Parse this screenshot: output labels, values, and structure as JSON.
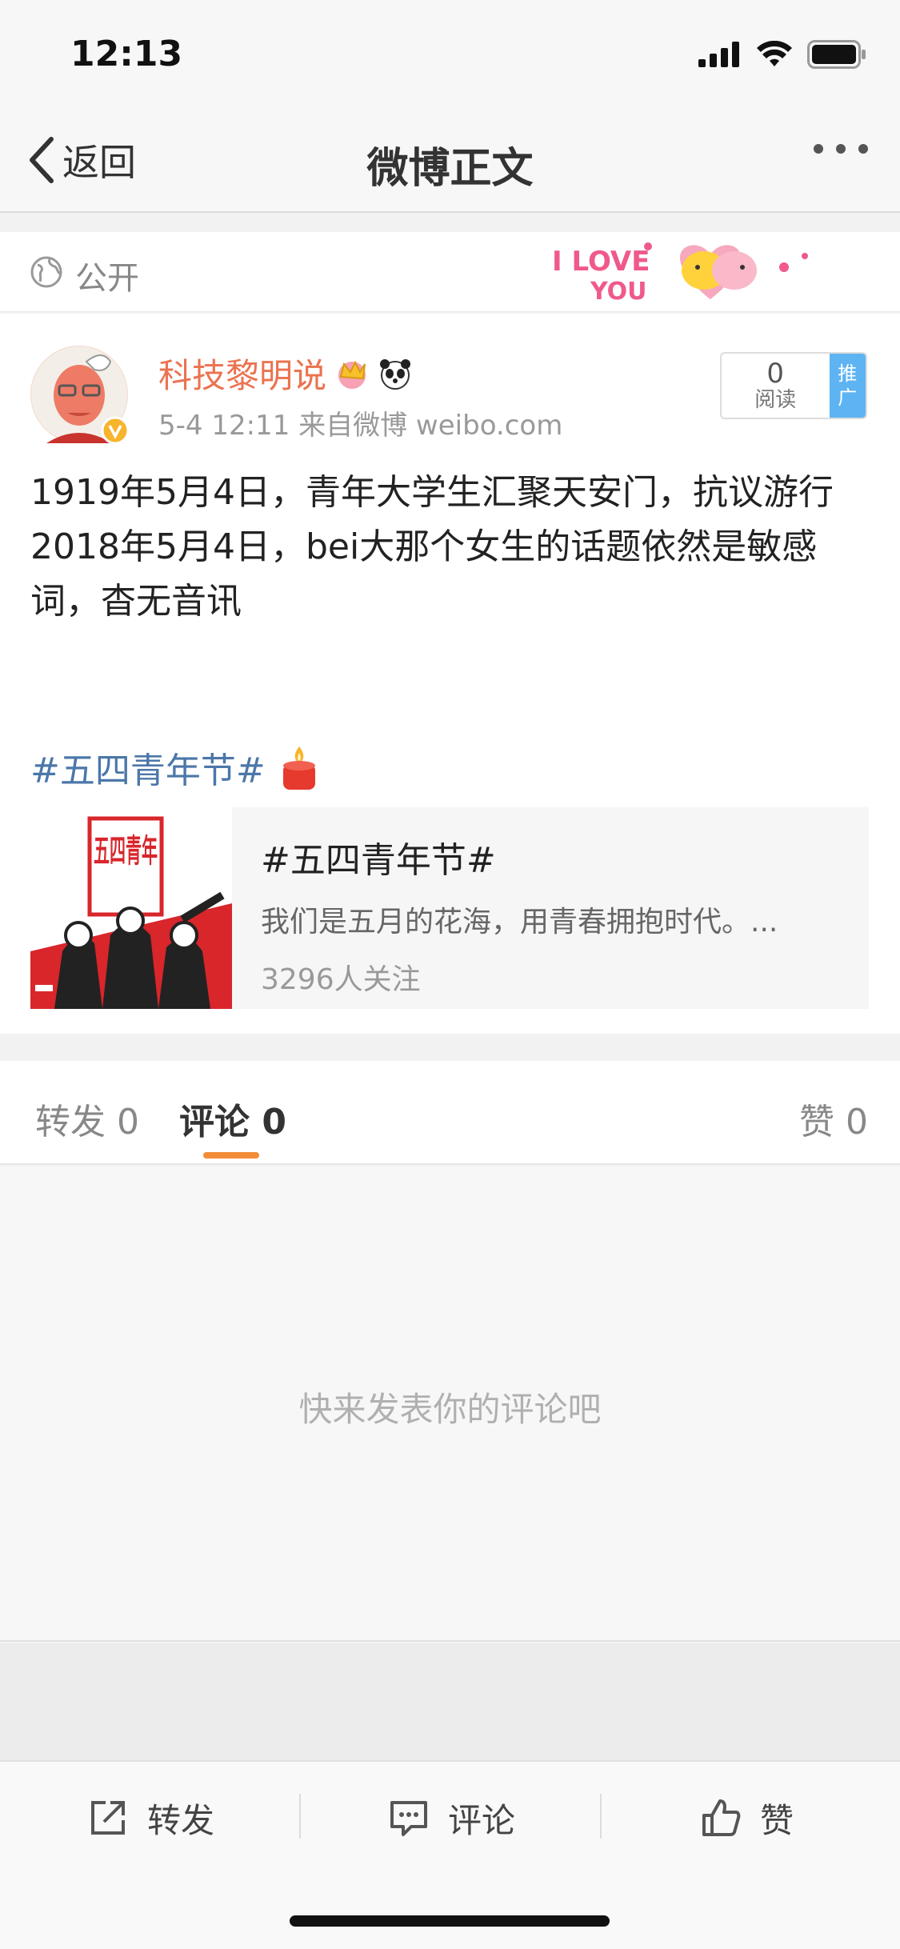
{
  "status_bar": {
    "time": "12:13"
  },
  "nav": {
    "back_label": "返回",
    "title": "微博正文"
  },
  "visibility": {
    "label": "公开",
    "decor_text_1": "I LOVE",
    "decor_text_2": "YOU"
  },
  "post": {
    "username": "科技黎明说",
    "meta": "5-4 12:11  来自微博 weibo.com",
    "read_count": "0",
    "read_label": "阅读",
    "promote_label_1": "推",
    "promote_label_2": "广",
    "text_line_1": "1919年5月4日，青年大学生汇聚天安门，抗议游行",
    "text_line_2": "2018年5月4日，bei大那个女生的话题依然是敏感词，杳无音讯",
    "hashtag": "#五四青年节#",
    "topic": {
      "title": "#五四青年节#",
      "description": "我们是五月的花海，用青春拥抱时代。...",
      "followers": "3296人关注",
      "image_text": "五四青年"
    }
  },
  "tabs": {
    "repost": "转发 0",
    "comment": "评论 0",
    "like": "赞 0"
  },
  "comments": {
    "empty_text": "快来发表你的评论吧"
  },
  "toolbar": {
    "repost": "转发",
    "comment": "评论",
    "like": "赞"
  },
  "colors": {
    "username": "#eb7350",
    "hashtag": "#4b77a9",
    "tab_underline": "#f28c38",
    "promote_badge": "#5eb3f2"
  }
}
